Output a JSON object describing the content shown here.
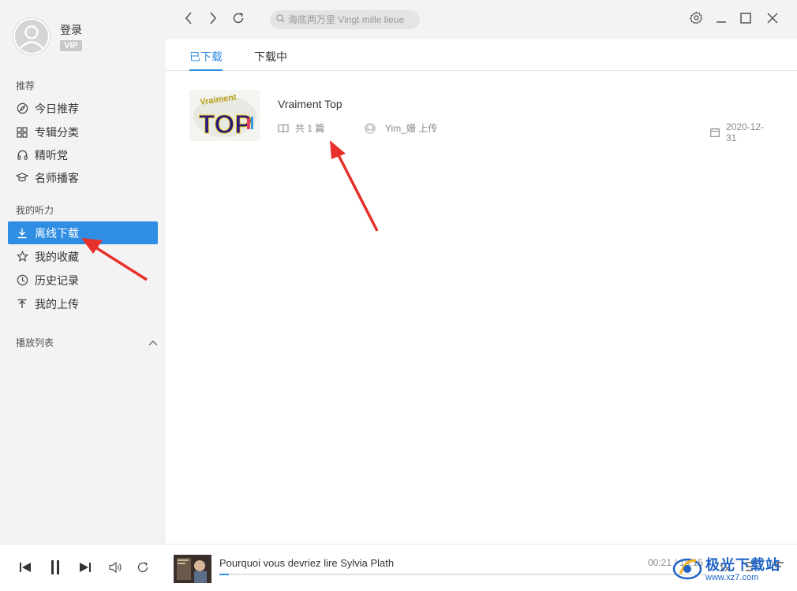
{
  "profile": {
    "login": "登录",
    "vip": "VIP"
  },
  "sidebar": {
    "recommend_title": "推荐",
    "recommend_items": [
      {
        "label": "今日推荐",
        "icon": "compass-icon"
      },
      {
        "label": "专辑分类",
        "icon": "grid-icon"
      },
      {
        "label": "精听党",
        "icon": "headphones-icon"
      },
      {
        "label": "名师播客",
        "icon": "graduation-cap-icon"
      }
    ],
    "my_title": "我的听力",
    "my_items": [
      {
        "label": "离线下载",
        "icon": "download-icon",
        "active": true
      },
      {
        "label": "我的收藏",
        "icon": "star-icon"
      },
      {
        "label": "历史记录",
        "icon": "clock-icon"
      },
      {
        "label": "我的上传",
        "icon": "upload-icon"
      }
    ],
    "playlist_title": "播放列表"
  },
  "topbar": {
    "search_placeholder": "海底两万里 Vingt mille lieue"
  },
  "tabs": [
    {
      "label": "已下载",
      "active": true
    },
    {
      "label": "下载中",
      "active": false
    }
  ],
  "album": {
    "cover_text": "TOP",
    "cover_text_small": "Vraiment",
    "title": "Vraiment Top",
    "count": "共 1 篇",
    "uploader": "Yim_姗 上传",
    "date": "2020-12-31"
  },
  "player": {
    "track_title": "Pourquoi vous devriez lire Sylvia Plath",
    "time": "00:21 / 18:15",
    "progress": 0.02,
    "speed": "1x"
  },
  "watermark": {
    "text": "极光下载站",
    "url": "www.xz7.com"
  },
  "colors": {
    "accent": "#2f8de4",
    "sidebar_bg": "#f3f3f3",
    "arrow": "#e8302a"
  }
}
